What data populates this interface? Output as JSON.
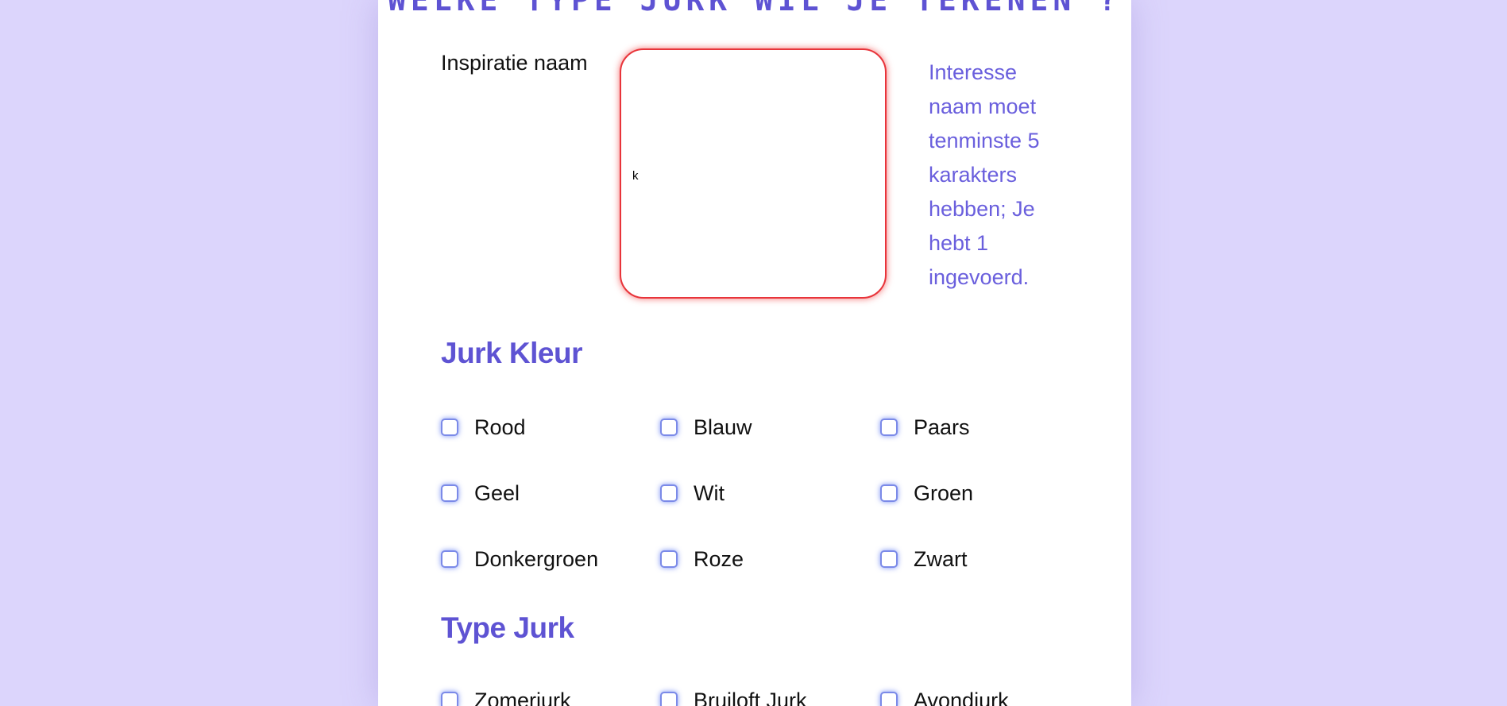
{
  "page": {
    "title": "WELKE TYPE JURK WIL JE TEKENEN ?"
  },
  "inspiration": {
    "label": "Inspiratie naam",
    "value": "k",
    "error": "Interesse naam moet tenminste 5 karakters hebben; Je hebt 1 ingevoerd."
  },
  "color_section": {
    "heading": "Jurk Kleur",
    "options": [
      "Rood",
      "Blauw",
      "Paars",
      "Geel",
      "Wit",
      "Groen",
      "Donkergroen",
      "Roze",
      "Zwart"
    ]
  },
  "type_section": {
    "heading": "Type Jurk",
    "options": [
      "Zomerjurk",
      "Bruiloft Jurk",
      "Avondjurk"
    ]
  },
  "colors": {
    "background": "#dcd5fc",
    "accent": "#5e53d3",
    "error_border": "#e8343a",
    "checkbox_border": "#7b8ae8"
  }
}
